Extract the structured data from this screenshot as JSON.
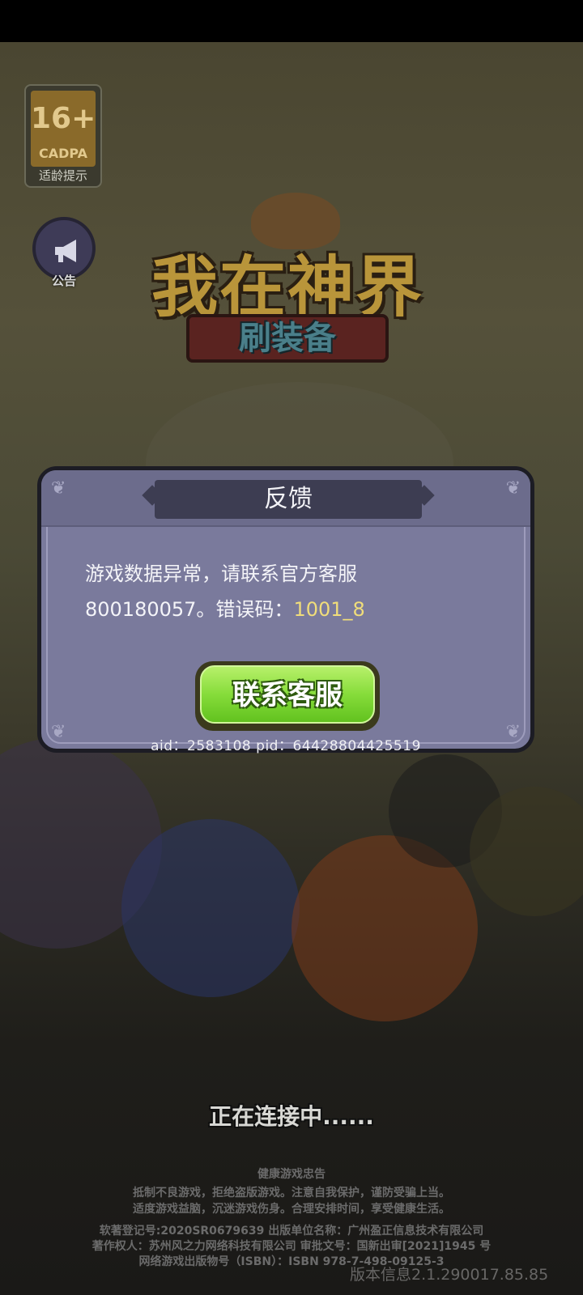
{
  "age_badge": {
    "rating": "16+",
    "org": "CADPA",
    "tip": "适龄提示"
  },
  "announce": {
    "label": "公告",
    "icon": "megaphone-icon"
  },
  "logo": {
    "title": "我在神界",
    "subtitle": "刷装备"
  },
  "dialog": {
    "title": "反馈",
    "message_line1": "游戏数据异常，请联系官方客服",
    "message_line2_prefix": "800180057。错误码：",
    "error_code": "1001_8",
    "button_label": "联系客服",
    "ids": "aid：2583108  pid：64428804425519"
  },
  "status": {
    "connecting": "正在连接中......"
  },
  "footer": {
    "health_title": "健康游戏忠告",
    "health_line1": "抵制不良游戏，拒绝盗版游戏。注意自我保护，谨防受骗上当。",
    "health_line2": "适度游戏益脑，沉迷游戏伤身。合理安排时间，享受健康生活。",
    "reg_line1": "软著登记号:2020SR0679639 出版单位名称：广州盈正信息技术有限公司",
    "reg_line2": "著作权人：苏州风之力网络科技有限公司 审批文号：国新出审[2021]1945 号",
    "reg_line3": "网络游戏出版物号（ISBN）：ISBN 978-7-498-09125-3"
  },
  "version": "版本信息2.1.290017.85.85",
  "colors": {
    "dialog_bg": "#7a7a9c",
    "button_green": "#86dc3a",
    "error_code": "#f0dd7a"
  }
}
